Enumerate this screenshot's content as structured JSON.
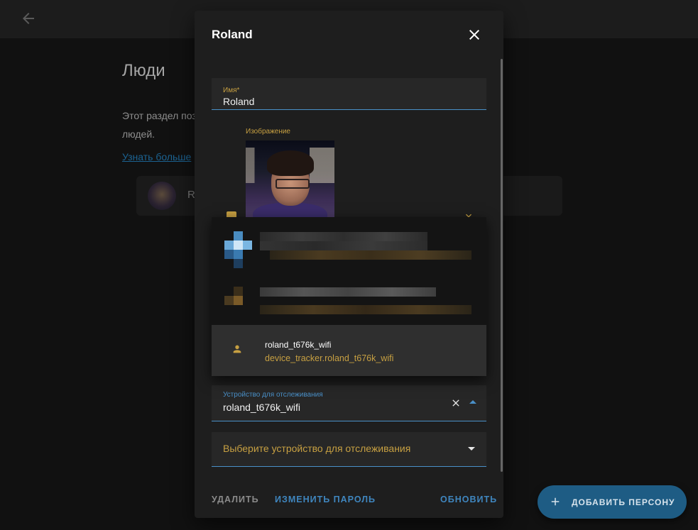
{
  "page": {
    "title": "Люди",
    "description_line1": "Этот раздел поз",
    "description_line2": "людей.",
    "learn_more": "Узнать больше",
    "person_card_name": "R"
  },
  "dialog": {
    "title": "Roland",
    "name_field": {
      "label": "Имя*",
      "value": "Roland"
    },
    "image_label": "Изображение",
    "tracker_field": {
      "label": "Устройство для отслеживания",
      "value": "roland_t676k_wifi"
    },
    "select_field": {
      "placeholder": "Выберите устройство для отслеживания"
    },
    "actions": {
      "delete": "УДАЛИТЬ",
      "change_password": "ИЗМЕНИТЬ ПАРОЛЬ",
      "update": "ОБНОВИТЬ"
    }
  },
  "menu": {
    "selected_item": {
      "title": "roland_t676k_wifi",
      "entity_id": "device_tracker.roland_t676k_wifi",
      "icon": "person-icon"
    },
    "blurred_items": 2
  },
  "fab": {
    "label": "ДОБАВИТЬ ПЕРСОНУ",
    "icon": "plus-icon"
  },
  "colors": {
    "accent_blue": "#4a90c8",
    "label_gold": "#c7a042",
    "dialog_bg": "#1e1e1e",
    "fab_bg": "#1e5c84"
  }
}
